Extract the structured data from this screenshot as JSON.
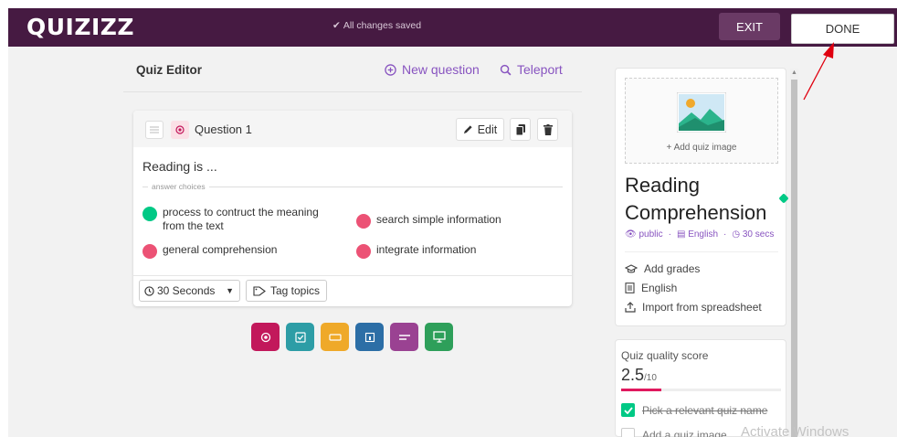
{
  "header": {
    "logo": "QUIZIZZ",
    "save_status": "All changes saved",
    "exit_label": "EXIT",
    "done_label": "DONE"
  },
  "editor": {
    "title": "Quiz Editor",
    "new_question_label": "New question",
    "teleport_label": "Teleport"
  },
  "question": {
    "label": "Question 1",
    "edit_label": "Edit",
    "text": "Reading is ...",
    "answer_choices_label": "answer choices",
    "answers": [
      {
        "text": "process to contruct the meaning from the text",
        "correct": true
      },
      {
        "text": "search simple information",
        "correct": false
      },
      {
        "text": "general comprehension",
        "correct": false
      },
      {
        "text": "integrate information",
        "correct": false
      }
    ],
    "time": "30 Seconds",
    "tag_label": "Tag topics"
  },
  "question_types": [
    {
      "icon": "multiple-choice-icon",
      "color": "#c2185b"
    },
    {
      "icon": "checkbox-icon",
      "color": "#2d9da6"
    },
    {
      "icon": "fill-blank-icon",
      "color": "#efa929"
    },
    {
      "icon": "poll-icon",
      "color": "#2c6ea6"
    },
    {
      "icon": "open-ended-icon",
      "color": "#9a4292"
    },
    {
      "icon": "slide-icon",
      "color": "#2e9f5a"
    }
  ],
  "quiz": {
    "add_image_label": "+ Add quiz image",
    "name": "Reading Comprehension",
    "visibility": "public",
    "language": "English",
    "time": "30 secs",
    "add_grades_label": "Add grades",
    "language_link": "English",
    "import_label": "Import from spreadsheet"
  },
  "quality": {
    "title": "Quiz quality score",
    "score": "2.5",
    "max": "/10",
    "fraction": 0.25,
    "items": [
      {
        "label": "Pick a relevant quiz name",
        "done": true
      },
      {
        "label": "Add a quiz image",
        "done": false
      }
    ]
  },
  "watermark": "Activate Windows",
  "colors": {
    "header_bg": "#461a42",
    "accent": "#8854c0",
    "correct": "#00c985",
    "incorrect": "#ec5275",
    "annotation": "#e0000f"
  }
}
